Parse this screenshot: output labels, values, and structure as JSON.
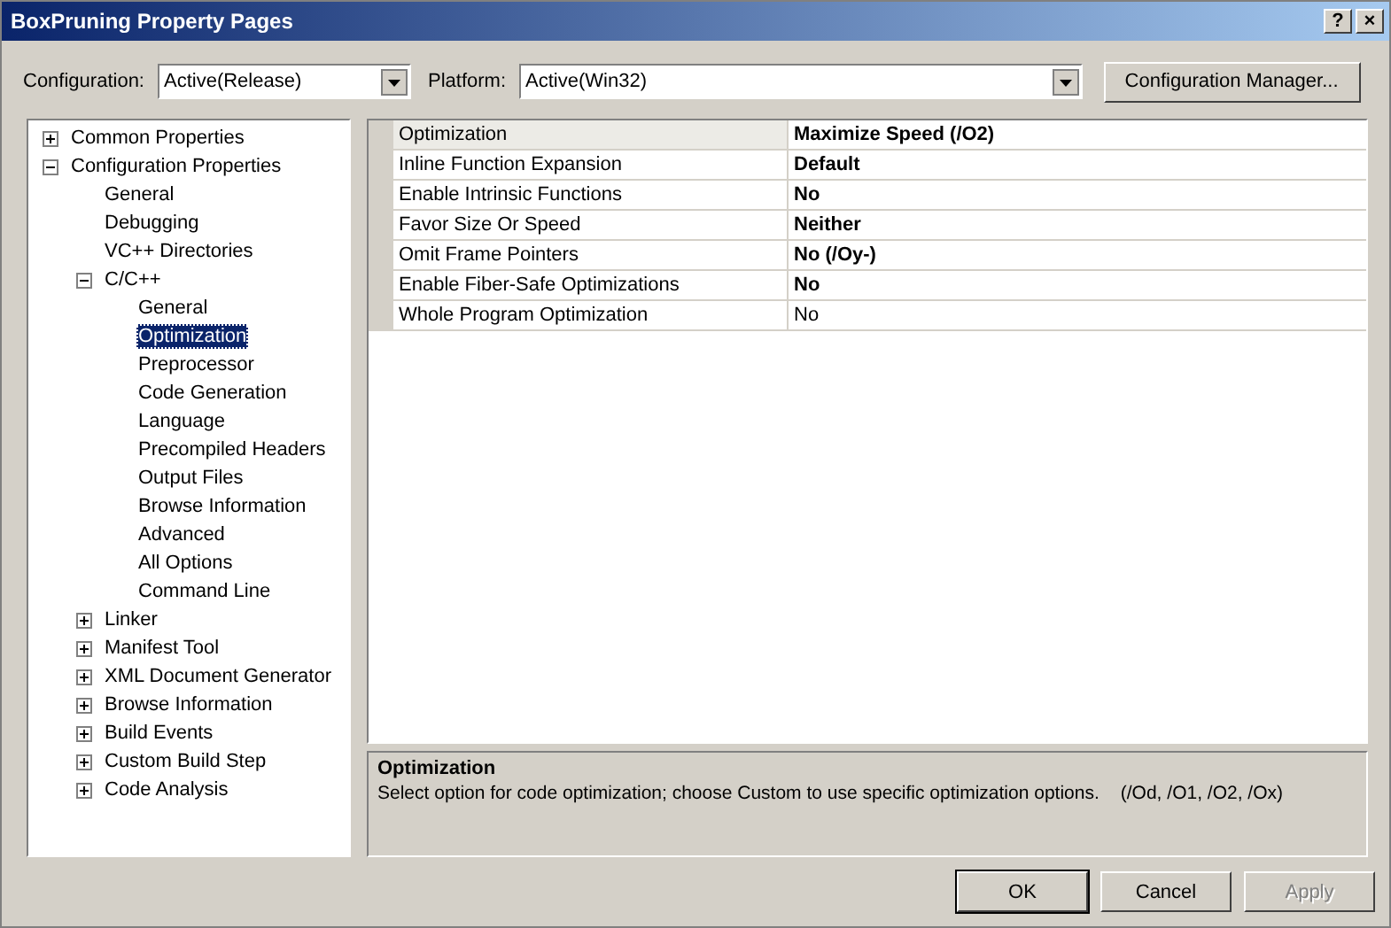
{
  "window": {
    "title": "BoxPruning Property Pages",
    "buttons": [
      "?",
      "×"
    ]
  },
  "configuration": {
    "label": "Configuration:",
    "value": "Active(Release)"
  },
  "platform": {
    "label": "Platform:",
    "value": "Active(Win32)"
  },
  "configuration_manager": "Configuration Manager...",
  "tree": [
    {
      "label": "Common Properties",
      "expanded": false,
      "selected": false
    },
    {
      "label": "Configuration Properties",
      "expanded": true,
      "selected": false,
      "children": [
        {
          "label": "General",
          "selected": false
        },
        {
          "label": "Debugging",
          "selected": false
        },
        {
          "label": "VC++ Directories",
          "selected": false
        },
        {
          "label": "C/C++",
          "expanded": true,
          "selected": false,
          "children": [
            {
              "label": "General",
              "selected": false
            },
            {
              "label": "Optimization",
              "selected": true
            },
            {
              "label": "Preprocessor",
              "selected": false
            },
            {
              "label": "Code Generation",
              "selected": false
            },
            {
              "label": "Language",
              "selected": false
            },
            {
              "label": "Precompiled Headers",
              "selected": false
            },
            {
              "label": "Output Files",
              "selected": false
            },
            {
              "label": "Browse Information",
              "selected": false
            },
            {
              "label": "Advanced",
              "selected": false
            },
            {
              "label": "All Options",
              "selected": false
            },
            {
              "label": "Command Line",
              "selected": false
            }
          ]
        },
        {
          "label": "Linker",
          "expanded": false,
          "selected": false
        },
        {
          "label": "Manifest Tool",
          "expanded": false,
          "selected": false
        },
        {
          "label": "XML Document Generator",
          "expanded": false,
          "selected": false
        },
        {
          "label": "Browse Information",
          "expanded": false,
          "selected": false
        },
        {
          "label": "Build Events",
          "expanded": false,
          "selected": false
        },
        {
          "label": "Custom Build Step",
          "expanded": false,
          "selected": false
        },
        {
          "label": "Code Analysis",
          "expanded": false,
          "selected": false
        }
      ]
    }
  ],
  "properties": [
    {
      "name": "Optimization",
      "value": "Maximize Speed (/O2)",
      "bold": true,
      "selected": true
    },
    {
      "name": "Inline Function Expansion",
      "value": "Default",
      "bold": true,
      "selected": false
    },
    {
      "name": "Enable Intrinsic Functions",
      "value": "No",
      "bold": true,
      "selected": false
    },
    {
      "name": "Favor Size Or Speed",
      "value": "Neither",
      "bold": true,
      "selected": false
    },
    {
      "name": "Omit Frame Pointers",
      "value": "No (/Oy-)",
      "bold": true,
      "selected": false
    },
    {
      "name": "Enable Fiber-Safe Optimizations",
      "value": "No",
      "bold": true,
      "selected": false
    },
    {
      "name": "Whole Program Optimization",
      "value": "No",
      "bold": false,
      "selected": false
    }
  ],
  "description": {
    "title": "Optimization",
    "text": "Select option for code optimization; choose Custom to use specific optimization options.",
    "switches": "(/Od, /O1, /O2, /Ox)"
  },
  "buttons": [
    {
      "label": "OK",
      "disabled": false,
      "default": true
    },
    {
      "label": "Cancel",
      "disabled": false,
      "default": false
    },
    {
      "label": "Apply",
      "disabled": true,
      "default": false
    }
  ]
}
